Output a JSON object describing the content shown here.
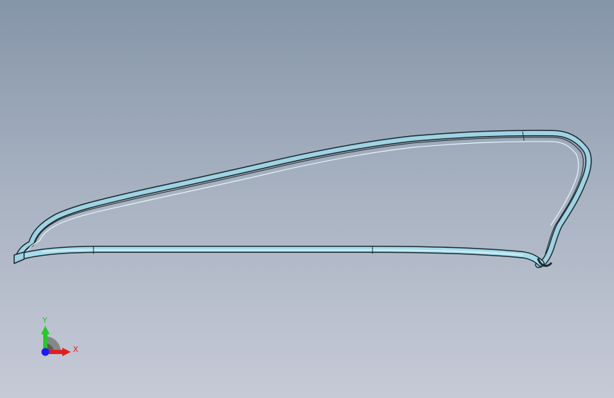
{
  "viewport": {
    "background_top": "#8595a8",
    "background_bottom": "#c6cad7"
  },
  "model": {
    "part": "weatherstrip-seal-profile",
    "body_color": "#9fd3e4",
    "edge_color": "#1b2a30"
  },
  "triad": {
    "x_label": "X",
    "y_label": "Y",
    "x_color": "#e02020",
    "y_color": "#22cc22",
    "z_color": "#1a1aff"
  }
}
